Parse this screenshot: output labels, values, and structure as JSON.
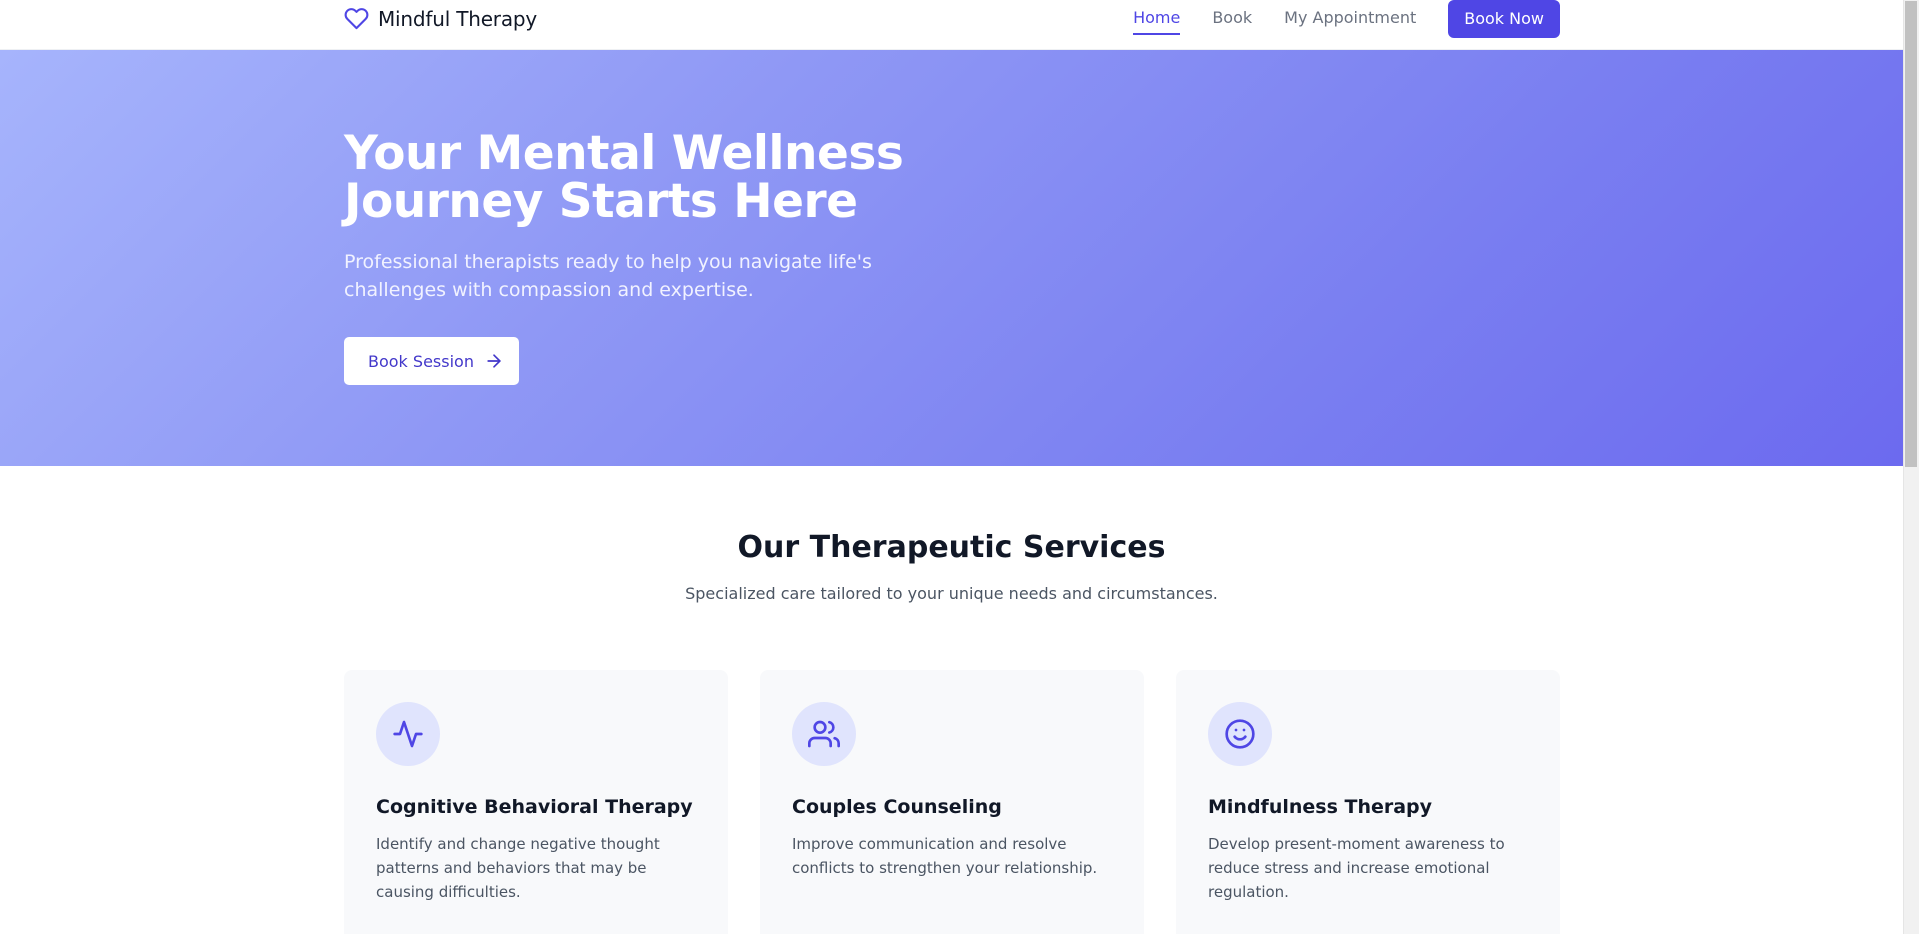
{
  "brand": {
    "name": "Mindful Therapy",
    "icon": "heart-icon"
  },
  "nav": {
    "links": [
      {
        "label": "Home",
        "active": true
      },
      {
        "label": "Book",
        "active": false
      },
      {
        "label": "My Appointment",
        "active": false
      }
    ],
    "cta_label": "Book Now"
  },
  "hero": {
    "title_line1": "Your Mental Wellness",
    "title_line2": "Journey Starts Here",
    "subtitle": "Professional therapists ready to help you navigate life's challenges with compassion and expertise.",
    "button_label": "Book Session",
    "button_icon": "arrow-right-icon"
  },
  "services": {
    "title": "Our Therapeutic Services",
    "subtitle": "Specialized care tailored to your unique needs and circumstances.",
    "cards": [
      {
        "icon": "activity-pulse-icon",
        "title": "Cognitive Behavioral Therapy",
        "description": "Identify and change negative thought patterns and behaviors that may be causing difficulties."
      },
      {
        "icon": "users-icon",
        "title": "Couples Counseling",
        "description": "Improve communication and resolve conflicts to strengthen your relationship."
      },
      {
        "icon": "smile-icon",
        "title": "Mindfulness Therapy",
        "description": "Develop present-moment awareness to reduce stress and increase emotional regulation."
      }
    ]
  },
  "colors": {
    "accent": "#4f46e5",
    "hero_gradient_start": "#a6b4fc",
    "hero_gradient_end": "#6c6aef",
    "card_bg": "#f8f9fb",
    "icon_circle_bg": "#e0e4fd"
  }
}
